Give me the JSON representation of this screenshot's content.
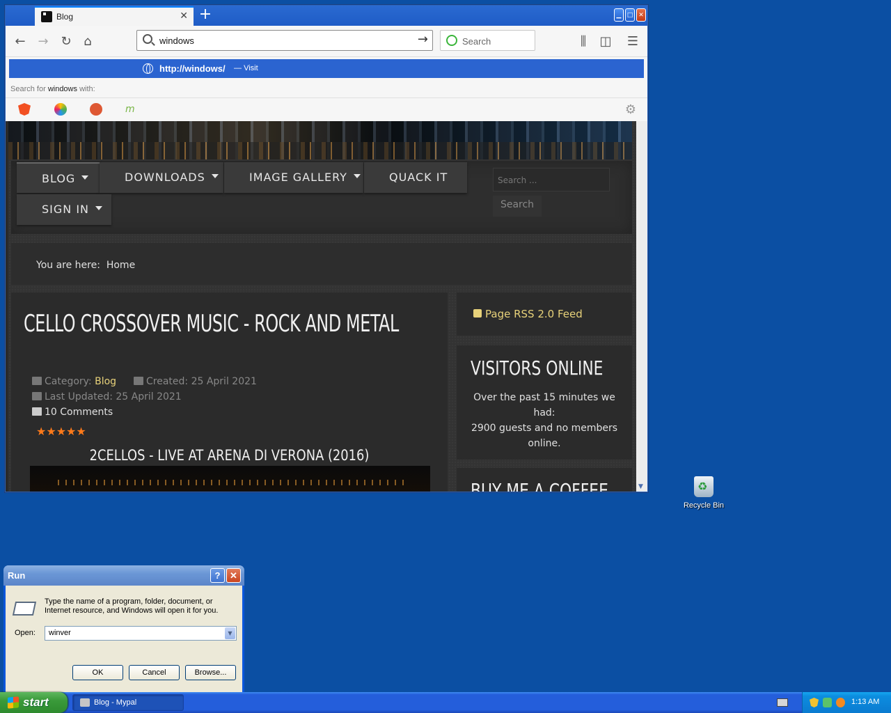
{
  "browser": {
    "tab_title": "Blog",
    "new_tab_label": "+",
    "url_value": "windows",
    "search_placeholder": "Search",
    "suggestion": {
      "url": "http://windows/",
      "dash": "—",
      "action": "Visit"
    },
    "search_with_prefix": "Search for",
    "search_with_term": "windows",
    "search_with_suffix": "with:",
    "engines": [
      {
        "name": "brave-engine-icon",
        "color": "#f25022"
      },
      {
        "name": "qwant-engine-icon",
        "color": "#5b8cf0"
      },
      {
        "name": "duckduckgo-engine-icon",
        "color": "#de5833"
      },
      {
        "name": "mojeek-engine-icon",
        "color": "#7ab648"
      }
    ]
  },
  "site": {
    "menu": [
      "BLOG",
      "DOWNLOADS",
      "IMAGE GALLERY",
      "QUACK IT",
      "SIGN IN"
    ],
    "search_placeholder": "Search ...",
    "search_button": "Search",
    "breadcrumb_prefix": "You are here:",
    "breadcrumb_current": "Home",
    "article": {
      "title": "CELLO CROSSOVER MUSIC - ROCK AND METAL",
      "category_label": "Category:",
      "category_value": "Blog",
      "created": "Created: 25 April 2021",
      "updated": "Last Updated: 25 April 2021",
      "comments": "10 Comments",
      "rating_stars": 5,
      "video_title": "2CELLOS - LIVE AT ARENA DI VERONA (2016)"
    },
    "rss_label": "Page RSS 2.0 Feed",
    "visitors_title": "VISITORS ONLINE",
    "visitors_line1": "Over the past 15 minutes we had:",
    "visitors_line2": "2900 guests and no members online.",
    "coffee_title": "BUY ME A COFFEE"
  },
  "desktop": {
    "recycle_bin_label": "Recycle Bin"
  },
  "run_dialog": {
    "title": "Run",
    "help": "?",
    "close": "✕",
    "description": "Type the name of a program, folder, document, or Internet resource, and Windows will open it for you.",
    "open_label": "Open:",
    "open_value": "winver",
    "ok": "OK",
    "cancel": "Cancel",
    "browse": "Browse..."
  },
  "taskbar": {
    "start_label": "start",
    "task_item": "Blog - Mypal",
    "clock": "1:13 AM"
  }
}
